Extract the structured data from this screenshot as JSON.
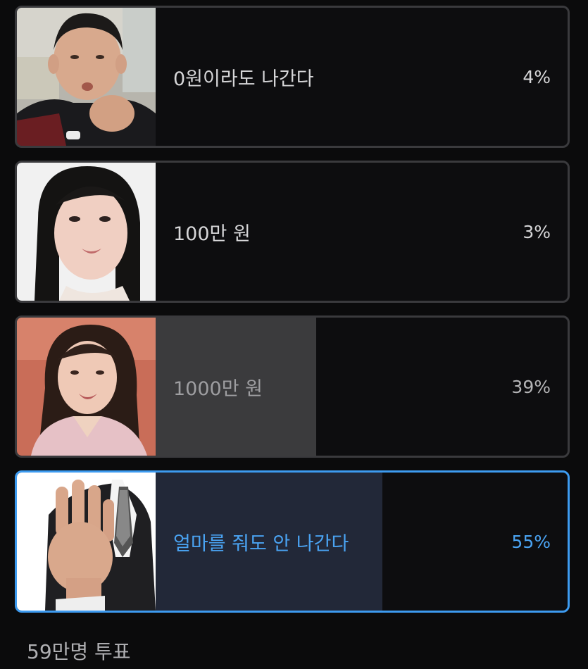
{
  "poll": {
    "options": [
      {
        "label": "0원이라도 나간다",
        "percent": "4%",
        "fill_fraction": 0.0,
        "photo": "bald-man-photo"
      },
      {
        "label": "100만 원",
        "percent": "3%",
        "fill_fraction": 0.0,
        "photo": "woman-hairband-photo"
      },
      {
        "label": "1000만 원",
        "percent": "39%",
        "fill_fraction": 0.39,
        "photo": "smiling-woman-photo"
      },
      {
        "label": "얼마를 줘도 안 나간다",
        "percent": "55%",
        "fill_fraction": 0.55,
        "photo": "hand-stop-photo",
        "selected": true
      }
    ],
    "vote_count": "59만명 투표"
  },
  "colors": {
    "background": "#0b0b0c",
    "border": "#3a3a3d",
    "fill": "#3b3b3d",
    "selected_accent": "#3d9bf0",
    "selected_fill": "#222838"
  }
}
